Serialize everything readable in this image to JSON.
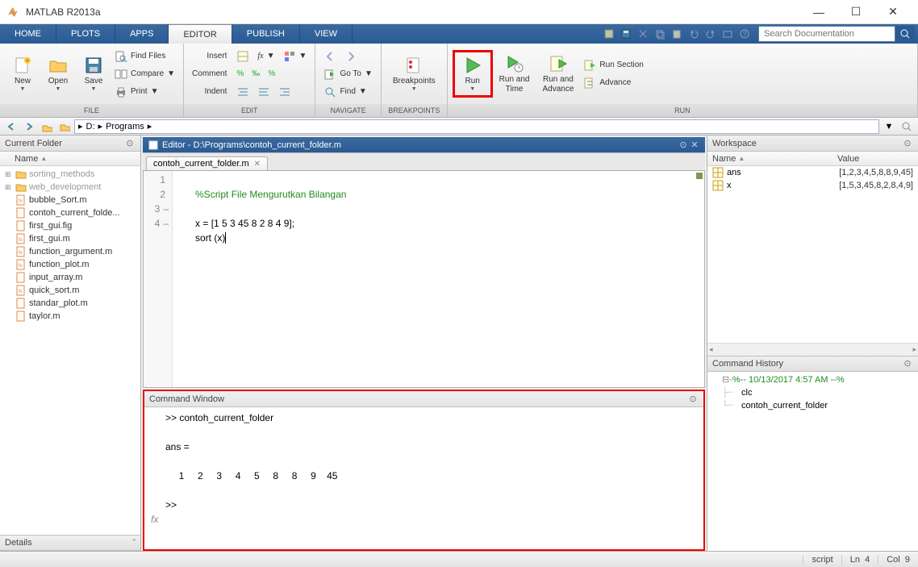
{
  "app": {
    "title": "MATLAB R2013a"
  },
  "tabs": [
    "HOME",
    "PLOTS",
    "APPS",
    "EDITOR",
    "PUBLISH",
    "VIEW"
  ],
  "active_tab": "EDITOR",
  "search": {
    "placeholder": "Search Documentation"
  },
  "ribbon": {
    "file": {
      "label": "FILE",
      "new": "New",
      "open": "Open",
      "save": "Save",
      "find_files": "Find Files",
      "compare": "Compare",
      "print": "Print"
    },
    "edit": {
      "label": "EDIT",
      "insert": "Insert",
      "comment": "Comment",
      "indent": "Indent",
      "goto": "Go To",
      "find": "Find"
    },
    "navigate": {
      "label": "NAVIGATE"
    },
    "breakpoints": {
      "label": "BREAKPOINTS",
      "btn": "Breakpoints"
    },
    "run": {
      "label": "RUN",
      "run": "Run",
      "run_time": "Run and\nTime",
      "run_advance": "Run and\nAdvance",
      "run_section": "Run Section",
      "advance": "Advance"
    }
  },
  "path": {
    "drive": "D:",
    "folder": "Programs"
  },
  "current_folder": {
    "title": "Current Folder",
    "col": "Name",
    "folders": [
      "sorting_methods",
      "web_development"
    ],
    "files": [
      "bubble_Sort.m",
      "contoh_current_folde...",
      "first_gui.fig",
      "first_gui.m",
      "function_argument.m",
      "function_plot.m",
      "input_array.m",
      "quick_sort.m",
      "standar_plot.m",
      "taylor.m"
    ],
    "details": "Details"
  },
  "editor": {
    "title": "Editor - D:\\Programs\\contoh_current_folder.m",
    "tab": "contoh_current_folder.m",
    "lines": [
      {
        "n": "1",
        "dash": "",
        "text": "%Script File Mengurutkan Bilangan",
        "cls": "comment"
      },
      {
        "n": "2",
        "dash": "",
        "text": ""
      },
      {
        "n": "3",
        "dash": "–",
        "text": "x = [1 5 3 45 8 2 8 4 9];"
      },
      {
        "n": "4",
        "dash": "–",
        "text": "sort (x)",
        "cursor": true
      }
    ]
  },
  "command_window": {
    "title": "Command Window",
    "output": ">> contoh_current_folder\n\nans =\n\n     1     2     3     4     5     8     8     9    45\n\n>> "
  },
  "workspace": {
    "title": "Workspace",
    "cols": [
      "Name",
      "Value"
    ],
    "vars": [
      {
        "name": "ans",
        "value": "[1,2,3,4,5,8,8,9,45]"
      },
      {
        "name": "x",
        "value": "[1,5,3,45,8,2,8,4,9]"
      }
    ]
  },
  "history": {
    "title": "Command History",
    "timestamp": "%-- 10/13/2017 4:57 AM --%",
    "entries": [
      "clc",
      "contoh_current_folder"
    ]
  },
  "status": {
    "mode": "script",
    "ln": "Ln",
    "ln_val": "4",
    "col": "Col",
    "col_val": "9"
  }
}
